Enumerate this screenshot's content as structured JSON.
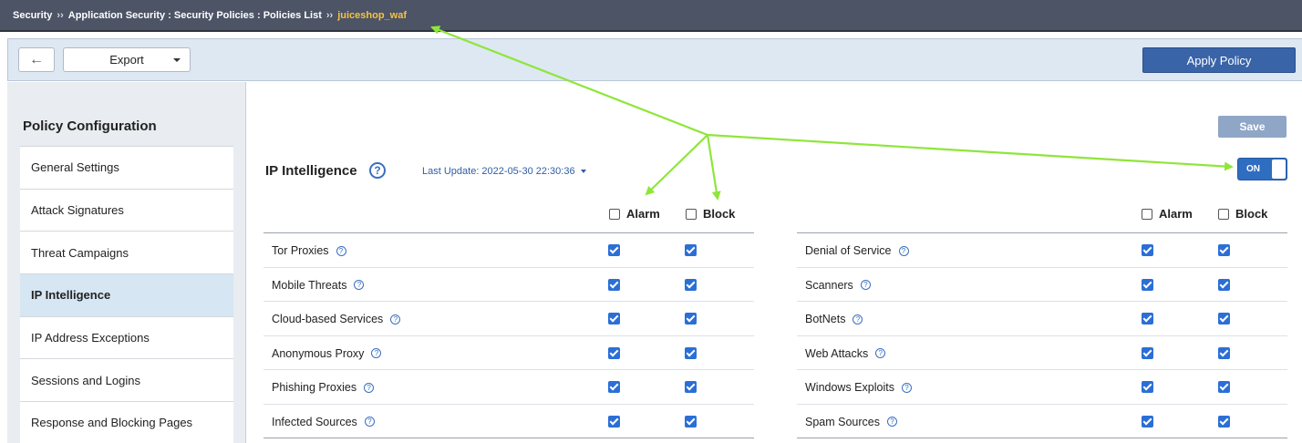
{
  "breadcrumb": {
    "items": [
      "Security",
      "Application Security : Security Policies : Policies List",
      "juiceshop_waf"
    ],
    "separator": "››"
  },
  "toolbar": {
    "back_icon": "arrow-left-icon",
    "export_label": "Export",
    "apply_label": "Apply Policy"
  },
  "sidebar": {
    "title": "Policy Configuration",
    "selected": "IP Intelligence",
    "items": [
      "General Settings",
      "Attack Signatures",
      "Threat Campaigns",
      "IP Intelligence",
      "IP Address Exceptions",
      "Sessions and Logins",
      "Response and Blocking Pages"
    ]
  },
  "main": {
    "save_label": "Save",
    "toggle_label": "ON",
    "toggle_on": true,
    "title": "IP Intelligence",
    "help_glyph": "?",
    "last_update": "Last Update: 2022-05-30 22:30:36",
    "alarm_label": "Alarm",
    "block_label": "Block",
    "left_rows": [
      {
        "name": "Tor Proxies",
        "alarm": true,
        "block": true
      },
      {
        "name": "Mobile Threats",
        "alarm": true,
        "block": true
      },
      {
        "name": "Cloud-based Services",
        "alarm": true,
        "block": true
      },
      {
        "name": "Anonymous Proxy",
        "alarm": true,
        "block": true
      },
      {
        "name": "Phishing Proxies",
        "alarm": true,
        "block": true
      },
      {
        "name": "Infected Sources",
        "alarm": true,
        "block": true
      }
    ],
    "right_rows": [
      {
        "name": "Denial of Service",
        "alarm": true,
        "block": true
      },
      {
        "name": "Scanners",
        "alarm": true,
        "block": true
      },
      {
        "name": "BotNets",
        "alarm": true,
        "block": true
      },
      {
        "name": "Web Attacks",
        "alarm": true,
        "block": true
      },
      {
        "name": "Windows Exploits",
        "alarm": true,
        "block": true
      },
      {
        "name": "Spam Sources",
        "alarm": true,
        "block": true
      }
    ]
  },
  "colors": {
    "accent": "#3a64a8",
    "annotation": "#8ee63a",
    "breadcrumb_active": "#f6c343"
  }
}
